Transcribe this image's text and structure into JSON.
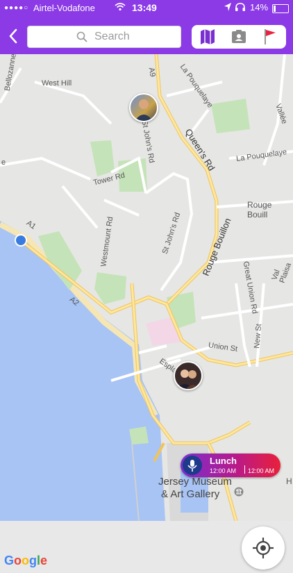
{
  "status_bar": {
    "signal_dots": "●●●●○",
    "carrier": "Airtel-Vodafone",
    "time": "13:49",
    "battery": "14%",
    "battery_fraction": 0.14
  },
  "header": {
    "search_placeholder": "Search"
  },
  "tabs": [
    {
      "icon": "map-icon"
    },
    {
      "icon": "contact-card-icon"
    },
    {
      "icon": "flag-icon"
    }
  ],
  "map": {
    "labels": {
      "west_hill": "West Hill",
      "a9": "A9",
      "la_pouquelaye_1": "La Pouquelaye",
      "la_pouquelaye_2": "La Pouquelaye",
      "queens_rd": "Queen's Rd",
      "st_johns_rd_1": "St John's Rd",
      "tower_rd": "Tower Rd",
      "westmount_rd": "Westmount Rd",
      "st_johns_rd_2": "St John's Rd",
      "rouge_bouillon_1": "Rouge Bouill",
      "rouge_bouillon_2": "Rouge Bouillon",
      "a1": "A1",
      "a2": "A2",
      "great_union_rd": "Great Union Rd",
      "val_plaisant": "Val Plaisa",
      "new_st": "New St",
      "union_st": "Union St",
      "esplanade": "Esplanade",
      "vallee": "Vallée",
      "bellozanne": "Bellozanne",
      "edge_e": "e",
      "edge_h": "H"
    },
    "museum_line1": "Jersey Museum",
    "museum_line2": "& Art Gallery",
    "event": {
      "title": "Lunch",
      "start": "12:00 AM",
      "end": "12:00 AM"
    },
    "google": [
      "G",
      "o",
      "o",
      "g",
      "l",
      "e"
    ],
    "google_colors": [
      "#4285f4",
      "#ea4335",
      "#fbbc05",
      "#4285f4",
      "#34a853",
      "#ea4335"
    ]
  }
}
